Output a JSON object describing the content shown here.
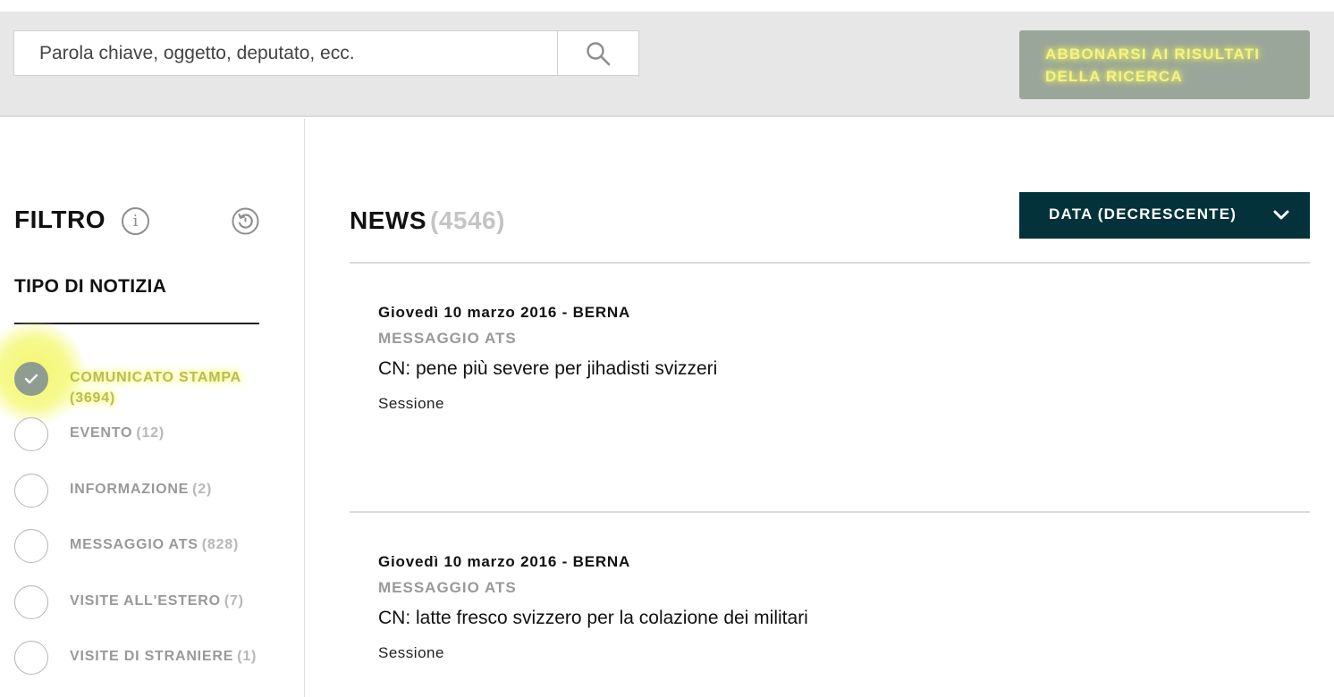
{
  "search": {
    "placeholder": "Parola chiave, oggetto, deputato, ecc.",
    "subscribe_line1": "ABBONARSI AI RISULTATI",
    "subscribe_line2": "DELLA RICERCA"
  },
  "sidebar": {
    "title": "FILTRO",
    "section_title": "TIPO DI NOTIZIA",
    "items": [
      {
        "label": "COMUNICATO STAMPA",
        "count": "(3694)",
        "checked": true
      },
      {
        "label": "EVENTO",
        "count": "(12)",
        "checked": false
      },
      {
        "label": "INFORMAZIONE",
        "count": "(2)",
        "checked": false
      },
      {
        "label": "MESSAGGIO ATS",
        "count": "(828)",
        "checked": false
      },
      {
        "label": "VISITE ALL'ESTERO",
        "count": "(7)",
        "checked": false
      },
      {
        "label": "VISITE DI STRANIERE",
        "count": "(1)",
        "checked": false
      }
    ]
  },
  "main": {
    "title": "NEWS",
    "count": "(4546)",
    "sort_label": "DATA (DECRESCENTE)",
    "news": [
      {
        "date": "Giovedì 10 marzo 2016 - BERNA",
        "type": "MESSAGGIO ATS",
        "headline": "CN: pene più severe per jihadisti svizzeri",
        "category": "Sessione"
      },
      {
        "date": "Giovedì 10 marzo 2016 - BERNA",
        "type": "MESSAGGIO ATS",
        "headline": "CN: latte fresco svizzero per la colazione dei militari",
        "category": "Sessione"
      }
    ]
  },
  "colors": {
    "dropdown_bg": "#04323a",
    "subscribe_bg": "#9aa69a",
    "highlight": "#f4f769",
    "checked_radio": "#8f9d90"
  }
}
